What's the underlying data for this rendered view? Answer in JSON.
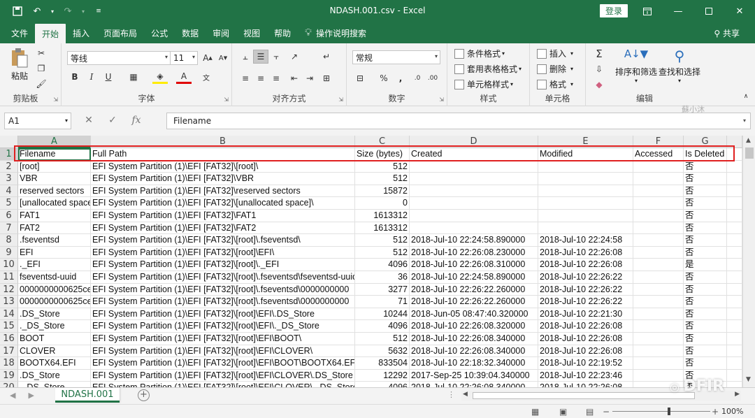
{
  "window": {
    "title": "NDASH.001.csv  -  Excel",
    "login_label": "登录",
    "quick_access": [
      "save-icon",
      "undo-icon",
      "redo-icon",
      "customize-icon"
    ]
  },
  "tabs": [
    {
      "label": "文件"
    },
    {
      "label": "开始",
      "active": true
    },
    {
      "label": "插入"
    },
    {
      "label": "页面布局"
    },
    {
      "label": "公式"
    },
    {
      "label": "数据"
    },
    {
      "label": "审阅"
    },
    {
      "label": "视图"
    },
    {
      "label": "帮助"
    },
    {
      "label": "操作说明搜索"
    }
  ],
  "share_label": "共享",
  "ribbon": {
    "clipboard": {
      "paste": "粘贴",
      "label": "剪贴板"
    },
    "font": {
      "name": "等线",
      "size": "11",
      "label": "字体"
    },
    "alignment": {
      "label": "对齐方式"
    },
    "number": {
      "format": "常规",
      "label": "数字"
    },
    "styles": {
      "conditional": "条件格式",
      "table": "套用表格格式",
      "cell": "单元格样式",
      "label": "样式"
    },
    "cells": {
      "insert": "插入",
      "delete": "删除",
      "format": "格式",
      "label": "单元格"
    },
    "editing": {
      "sort": "排序和筛选",
      "find": "查找和选择",
      "label": "编辑"
    }
  },
  "formula_bar": {
    "name_box": "A1",
    "content": "Filename"
  },
  "watermark_top": "蘇小沐",
  "columns": [
    {
      "letter": "A",
      "header": "Filename"
    },
    {
      "letter": "B",
      "header": "Full Path"
    },
    {
      "letter": "C",
      "header": "Size (bytes)"
    },
    {
      "letter": "D",
      "header": "Created"
    },
    {
      "letter": "E",
      "header": "Modified"
    },
    {
      "letter": "F",
      "header": "Accessed"
    },
    {
      "letter": "G",
      "header": "Is Deleted"
    }
  ],
  "rows": [
    {
      "n": "2",
      "a": "[root]",
      "b": "EFI System Partition (1)\\EFI [FAT32]\\[root]\\",
      "c": "512",
      "d": "",
      "e": "",
      "g": "否"
    },
    {
      "n": "3",
      "a": "VBR",
      "b": "EFI System Partition (1)\\EFI [FAT32]\\VBR",
      "c": "512",
      "d": "",
      "e": "",
      "g": "否"
    },
    {
      "n": "4",
      "a": "reserved sectors",
      "b": "EFI System Partition (1)\\EFI [FAT32]\\reserved sectors",
      "c": "15872",
      "d": "",
      "e": "",
      "g": "否"
    },
    {
      "n": "5",
      "a": "[unallocated space]",
      "b": "EFI System Partition (1)\\EFI [FAT32]\\[unallocated space]\\",
      "c": "0",
      "d": "",
      "e": "",
      "g": "否"
    },
    {
      "n": "6",
      "a": "FAT1",
      "b": "EFI System Partition (1)\\EFI [FAT32]\\FAT1",
      "c": "1613312",
      "d": "",
      "e": "",
      "g": "否"
    },
    {
      "n": "7",
      "a": "FAT2",
      "b": "EFI System Partition (1)\\EFI [FAT32]\\FAT2",
      "c": "1613312",
      "d": "",
      "e": "",
      "g": "否"
    },
    {
      "n": "8",
      "a": ".fseventsd",
      "b": "EFI System Partition (1)\\EFI [FAT32]\\[root]\\.fseventsd\\",
      "c": "512",
      "d": "2018-Jul-10 22:24:58.890000",
      "e": "2018-Jul-10 22:24:58",
      "g": "否"
    },
    {
      "n": "9",
      "a": "EFI",
      "b": "EFI System Partition (1)\\EFI [FAT32]\\[root]\\EFI\\",
      "c": "512",
      "d": "2018-Jul-10 22:26:08.230000",
      "e": "2018-Jul-10 22:26:08",
      "g": "否"
    },
    {
      "n": "10",
      "a": "._EFI",
      "b": "EFI System Partition (1)\\EFI [FAT32]\\[root]\\._EFI",
      "c": "4096",
      "d": "2018-Jul-10 22:26:08.310000",
      "e": "2018-Jul-10 22:26:08",
      "g": "是"
    },
    {
      "n": "11",
      "a": "fseventsd-uuid",
      "b": "EFI System Partition (1)\\EFI [FAT32]\\[root]\\.fseventsd\\fseventsd-uuid",
      "c": "36",
      "d": "2018-Jul-10 22:24:58.890000",
      "e": "2018-Jul-10 22:26:22",
      "g": "否"
    },
    {
      "n": "12",
      "a": "0000000000625ce",
      "b": "EFI System Partition (1)\\EFI [FAT32]\\[root]\\.fseventsd\\0000000000",
      "c": "3277",
      "d": "2018-Jul-10 22:26:22.260000",
      "e": "2018-Jul-10 22:26:22",
      "g": "否"
    },
    {
      "n": "13",
      "a": "0000000000625ce",
      "b": "EFI System Partition (1)\\EFI [FAT32]\\[root]\\.fseventsd\\0000000000",
      "c": "71",
      "d": "2018-Jul-10 22:26:22.260000",
      "e": "2018-Jul-10 22:26:22",
      "g": "否"
    },
    {
      "n": "14",
      "a": ".DS_Store",
      "b": "EFI System Partition (1)\\EFI [FAT32]\\[root]\\EFI\\.DS_Store",
      "c": "10244",
      "d": "2018-Jun-05 08:47:40.320000",
      "e": "2018-Jul-10 22:21:30",
      "g": "否"
    },
    {
      "n": "15",
      "a": "._DS_Store",
      "b": "EFI System Partition (1)\\EFI [FAT32]\\[root]\\EFI\\._DS_Store",
      "c": "4096",
      "d": "2018-Jul-10 22:26:08.320000",
      "e": "2018-Jul-10 22:26:08",
      "g": "否"
    },
    {
      "n": "16",
      "a": "BOOT",
      "b": "EFI System Partition (1)\\EFI [FAT32]\\[root]\\EFI\\BOOT\\",
      "c": "512",
      "d": "2018-Jul-10 22:26:08.340000",
      "e": "2018-Jul-10 22:26:08",
      "g": "否"
    },
    {
      "n": "17",
      "a": "CLOVER",
      "b": "EFI System Partition (1)\\EFI [FAT32]\\[root]\\EFI\\CLOVER\\",
      "c": "5632",
      "d": "2018-Jul-10 22:26:08.340000",
      "e": "2018-Jul-10 22:26:08",
      "g": "否"
    },
    {
      "n": "18",
      "a": "BOOTX64.EFI",
      "b": "EFI System Partition (1)\\EFI [FAT32]\\[root]\\EFI\\BOOT\\BOOTX64.EFI",
      "c": "833504",
      "d": "2018-Jul-10 22:18:32.340000",
      "e": "2018-Jul-10 22:19:52",
      "g": "否"
    },
    {
      "n": "19",
      "a": ".DS_Store",
      "b": "EFI System Partition (1)\\EFI [FAT32]\\[root]\\EFI\\CLOVER\\.DS_Store",
      "c": "12292",
      "d": "2017-Sep-25 10:39:04.340000",
      "e": "2018-Jul-10 22:23:46",
      "g": "否"
    },
    {
      "n": "20",
      "a": "._DS_Store",
      "b": "EFI System Partition (1)\\EFI [FAT32]\\[root]\\EFI\\CLOVER\\._DS_Store",
      "c": "4096",
      "d": "2018-Jul-10 22:26:08.340000",
      "e": "2018-Jul-10 22:26:08",
      "g": "否"
    }
  ],
  "sheet": {
    "name": "NDASH.001"
  },
  "status": {
    "zoom": "100%"
  },
  "watermark_bottom": "DFIR",
  "colors": {
    "accent": "#217346",
    "highlight": "#e02020"
  }
}
